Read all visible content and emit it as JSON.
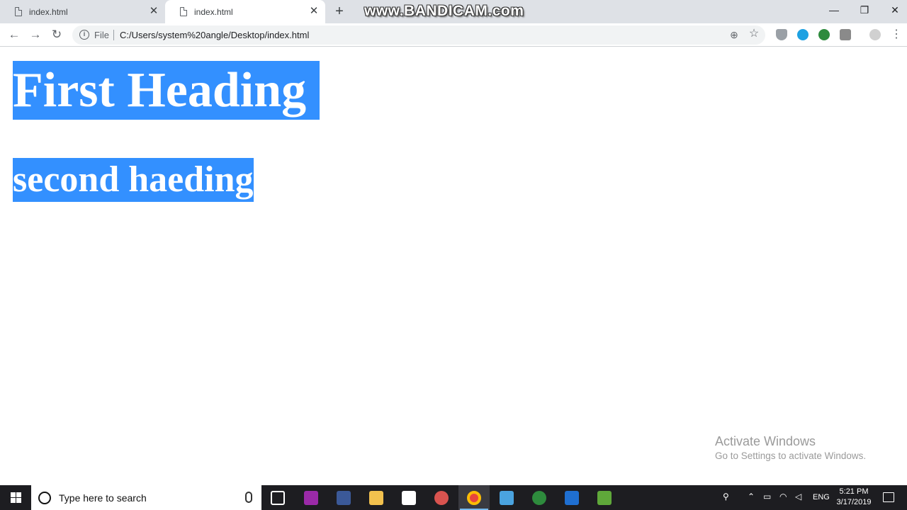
{
  "browser": {
    "tabs": [
      {
        "title": "index.html",
        "active": false
      },
      {
        "title": "index.html",
        "active": true
      }
    ],
    "watermark": "www.BANDICAM.com",
    "address": {
      "scheme_label": "File",
      "url": "C:/Users/system%20angle/Desktop/index.html"
    }
  },
  "page": {
    "heading1": "First Heading",
    "heading2": "second haeding",
    "selection_color": "#3390ff"
  },
  "activation_notice": {
    "title": "Activate Windows",
    "subtitle": "Go to Settings to activate Windows."
  },
  "taskbar": {
    "search_placeholder": "Type here to search",
    "language": "ENG",
    "time": "5:21 PM",
    "date": "3/17/2019"
  },
  "icons": {
    "tab": "document-icon",
    "close": "close-icon",
    "new_tab": "plus-icon",
    "back": "back-arrow-icon",
    "forward": "forward-arrow-icon",
    "reload": "reload-icon",
    "zoom": "zoom-icon",
    "bookmark": "star-icon"
  }
}
